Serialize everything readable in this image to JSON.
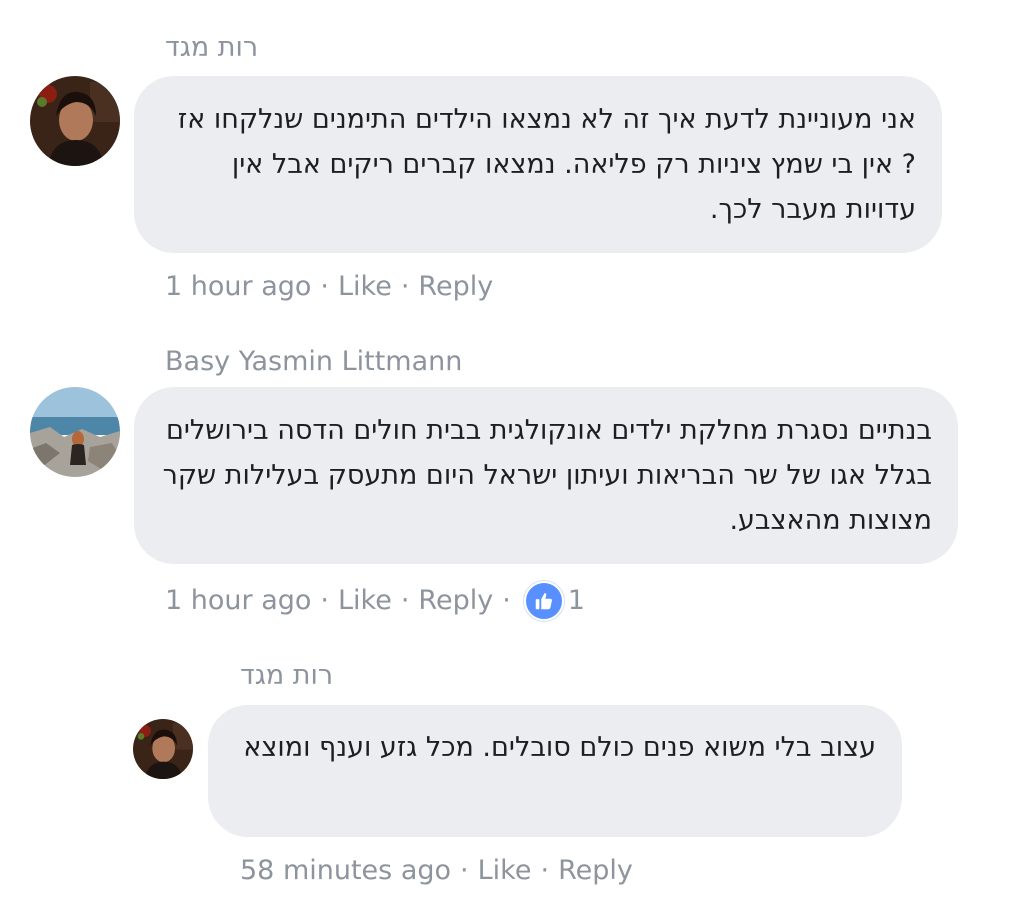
{
  "comments": [
    {
      "author": "רות מגד",
      "text": "אני מעוניינת לדעת איך זה לא נמצאו הילדים התימנים שנלקחו אז ?  אין בי שמץ ציניות רק פליאה. נמצאו קברים ריקים אבל אין עדויות מעבר לכך.",
      "time": "1 hour ago",
      "like_label": "Like",
      "reply_label": "Reply",
      "avatar": "woman-portrait-avatar"
    },
    {
      "author": "Basy Yasmin Littmann",
      "text": "בנתיים נסגרת מחלקת ילדים אונקולגית בבית חולים הדסה בירושלים בגלל אגו של שר הבריאות ועיתון ישראל היום מתעסק בעלילות שקר מצוצות מהאצבע.",
      "time": "1 hour ago",
      "like_label": "Like",
      "reply_label": "Reply",
      "reaction_count": "1",
      "reaction_icon": "thumbs-up-icon",
      "reaction_color": "#5890ff",
      "avatar": "seaside-rocks-avatar"
    },
    {
      "author": "רות מגד",
      "text": "עצוב בלי משוא פנים כולם סובלים. מכל גזע וענף ומוצא",
      "time": "58 minutes ago",
      "like_label": "Like",
      "reply_label": "Reply",
      "avatar": "woman-portrait-avatar"
    }
  ],
  "meta_separator": "·",
  "colors": {
    "bubble": "#ebedf0",
    "meta_text": "#8d949e",
    "body_text": "#1c1e21",
    "like_blue": "#5890ff"
  }
}
